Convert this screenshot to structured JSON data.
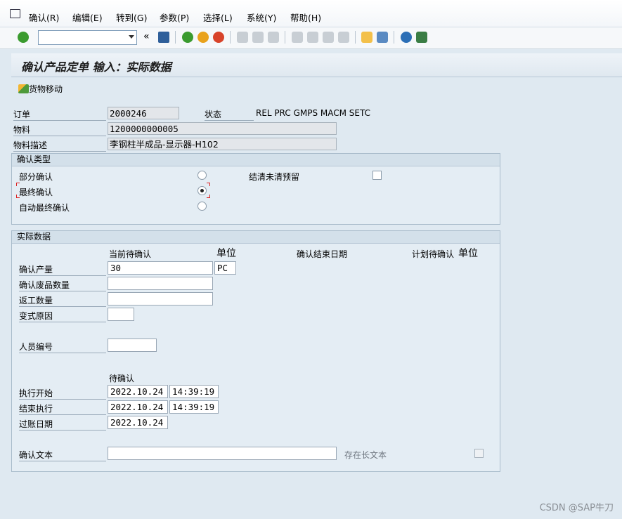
{
  "menu": {
    "items": [
      "确认(R)",
      "编辑(E)",
      "转到(G)",
      "参数(P)",
      "选择(L)",
      "系统(Y)",
      "帮助(H)"
    ]
  },
  "toolbar": {
    "icons": [
      "enter-icon",
      "save-icon",
      "back-icon",
      "exit-icon",
      "cancel-icon",
      "print-icon",
      "find-icon",
      "find-next-icon",
      "first-page-icon",
      "prev-page-icon",
      "next-page-icon",
      "last-page-icon",
      "new-session-icon",
      "shortcut-icon",
      "help-icon",
      "layout-icon"
    ],
    "collapse_glyph": "«"
  },
  "page": {
    "title": "确认产品定单 输入：实际数据"
  },
  "app_toolbar": {
    "goods_movement_label": "货物移动"
  },
  "header": {
    "order_label": "订单",
    "order_value": "2000246",
    "status_label": "状态",
    "status_value": "REL  PRC  GMPS MACM SETC",
    "material_label": "物料",
    "material_value": "1200000000005",
    "material_desc_label": "物料描述",
    "material_desc_value": "李钢柱半成品-显示器-H102"
  },
  "confirm_type": {
    "title": "确认类型",
    "partial_label": "部分确认",
    "final_label": "最终确认",
    "auto_final_label": "自动最终确认",
    "clear_reservation_label": "结清未清预留",
    "selected": "final"
  },
  "actual_data": {
    "title": "实际数据",
    "col_current_label": "当前待确认",
    "col_unit_label": "单位",
    "col_end_date_label": "确认结束日期",
    "col_planned_label": "计划待确认",
    "col_unit2_label": "单位",
    "yield_label": "确认产量",
    "yield_value": "30",
    "yield_unit": "PC",
    "scrap_label": "确认废品数量",
    "scrap_value": "",
    "rework_label": "返工数量",
    "rework_value": "",
    "variance_label": "变式原因",
    "variance_value": "",
    "personnel_label": "人员编号",
    "personnel_value": "",
    "pending_label": "待确认",
    "exec_start_label": "执行开始",
    "exec_start_date": "2022.10.24",
    "exec_start_time": "14:39:19",
    "exec_end_label": "结束执行",
    "exec_end_date": "2022.10.24",
    "exec_end_time": "14:39:19",
    "posting_label": "过账日期",
    "posting_date": "2022.10.24",
    "confirm_text_label": "确认文本",
    "confirm_text_value": "",
    "long_text_label": "存在长文本"
  },
  "watermark": "CSDN @SAP牛刀",
  "colors": {
    "accent_green": "#3b9b2f",
    "accent_orange": "#e9a21c",
    "accent_red": "#d8432a",
    "help_blue": "#2c6fb6"
  }
}
